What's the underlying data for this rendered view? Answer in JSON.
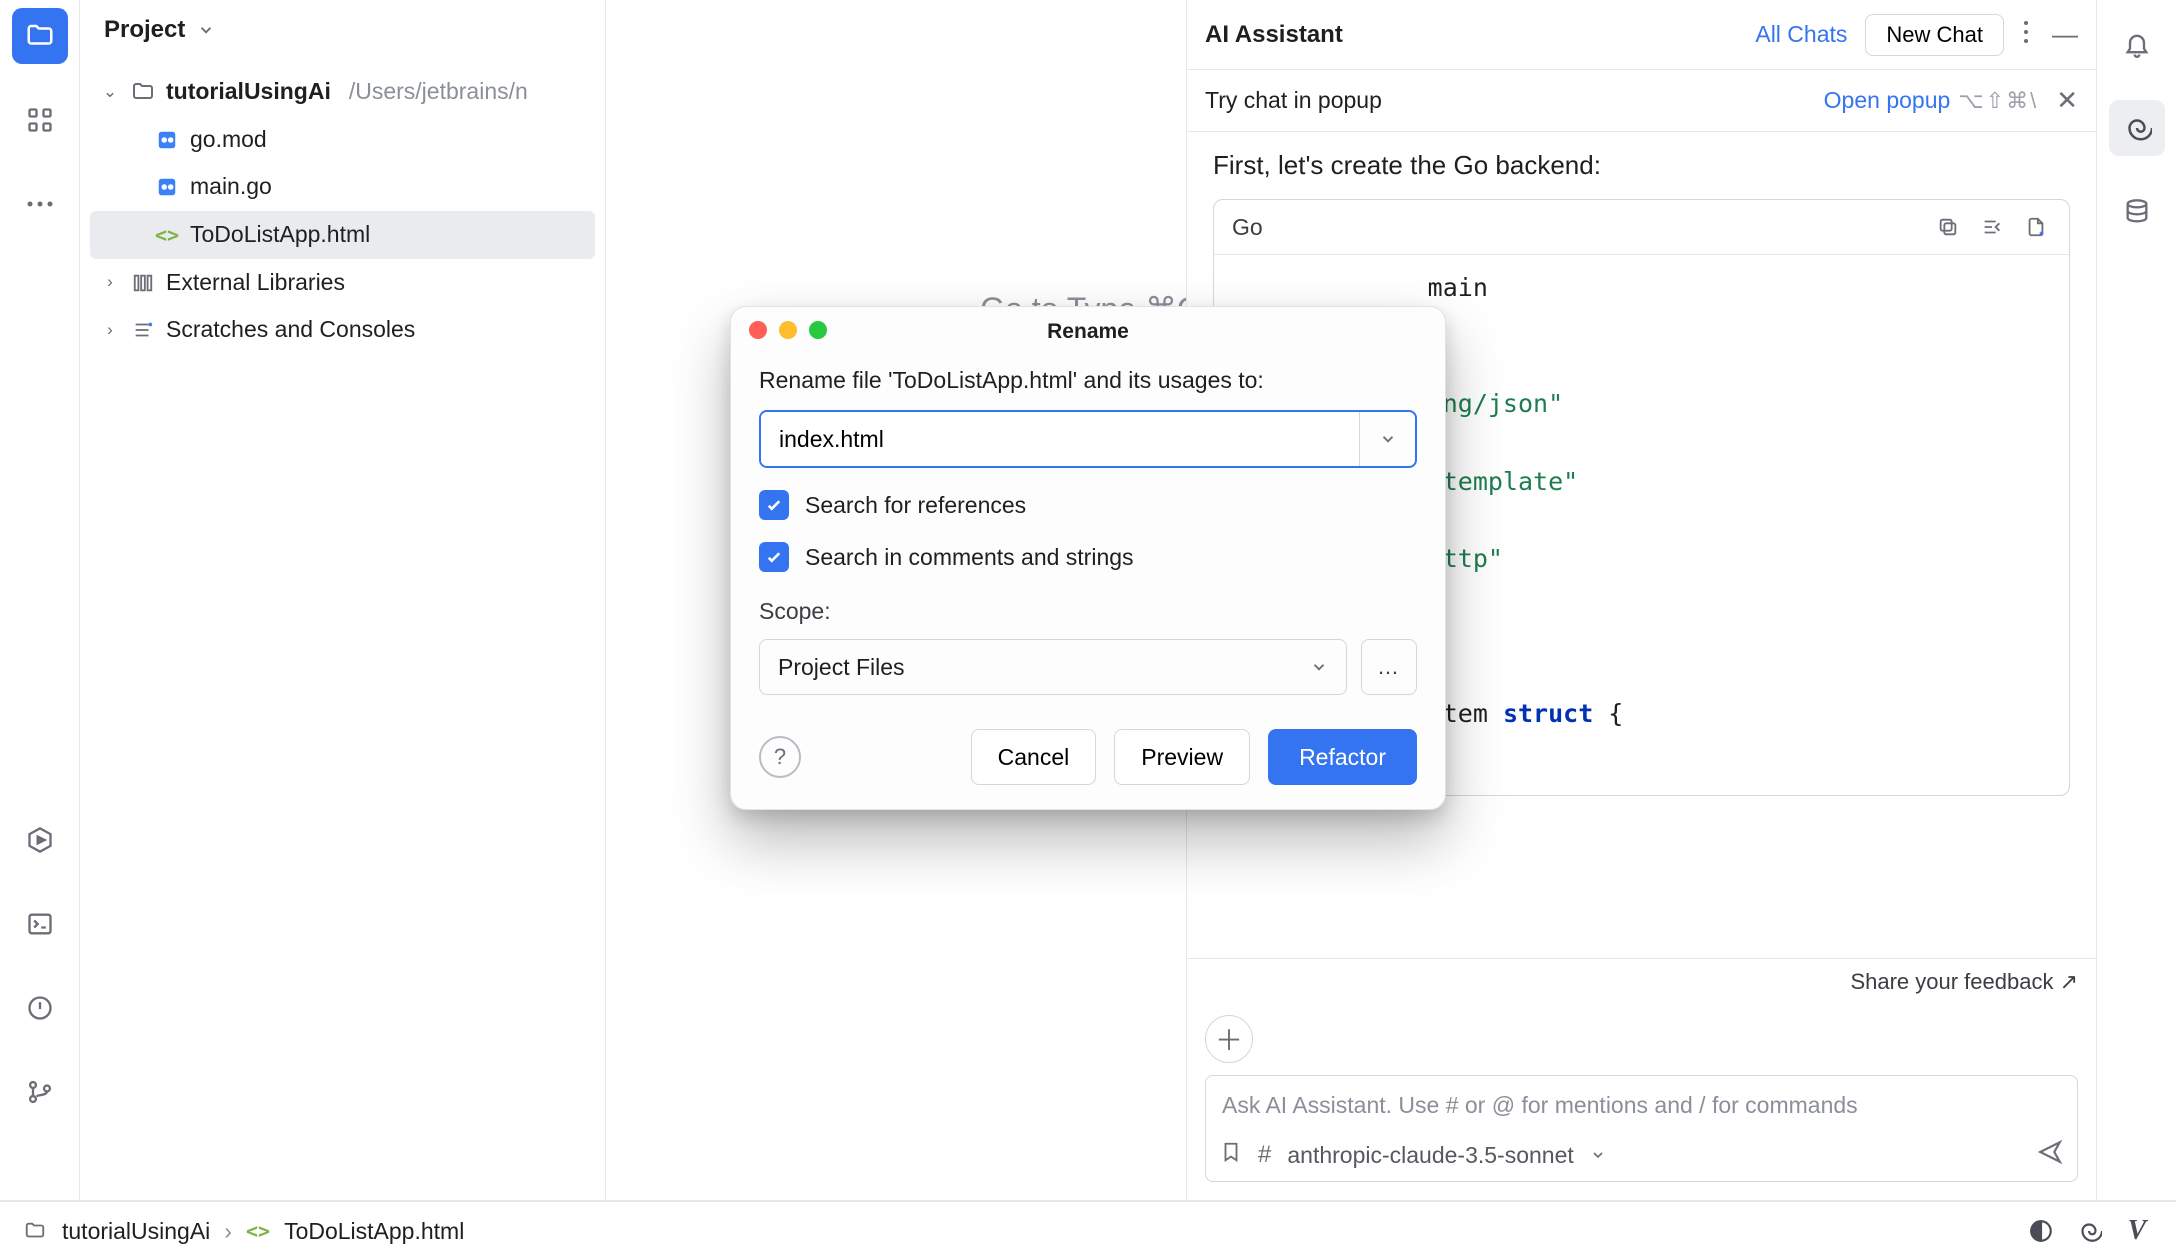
{
  "left_gutter": {
    "project_active": true
  },
  "project_panel": {
    "title": "Project",
    "root": {
      "name": "tutorialUsingAi",
      "path": "/Users/jetbrains/n"
    },
    "files": [
      {
        "icon": "go-file-icon",
        "name": "go.mod"
      },
      {
        "icon": "go-file-icon",
        "name": "main.go"
      },
      {
        "icon": "html-file-icon",
        "name": "ToDoListApp.html",
        "selected": true
      }
    ],
    "external_libs_label": "External Libraries",
    "scratches_label": "Scratches and Consoles"
  },
  "editor": {
    "placeholder_hint": "Go to Type ⌘O"
  },
  "ai": {
    "title": "AI Assistant",
    "all_chats": "All Chats",
    "new_chat": "New Chat",
    "popup_row_label": "Try chat in popup",
    "open_popup": "Open popup",
    "open_popup_shortcut": "⌥⇧⌘\\",
    "message": "First, let's create the Go backend:",
    "code_lang": "Go",
    "code_visible": "main\n\n\nding/json\"\n\"\nl/template\"\n\"\n/http\"\nc\"\n\n\noItem struct {",
    "feedback": "Share your feedback ↗",
    "input_placeholder": "Ask AI Assistant. Use # or @ for mentions and / for commands",
    "model": "anthropic-claude-3.5-sonnet"
  },
  "dialog": {
    "title": "Rename",
    "prompt": "Rename file 'ToDoListApp.html' and its usages to:",
    "value": "index.html",
    "chk_refs": "Search for references",
    "chk_comments": "Search in comments and strings",
    "scope_label": "Scope:",
    "scope_value": "Project Files",
    "scope_more": "…",
    "btn_cancel": "Cancel",
    "btn_preview": "Preview",
    "btn_refactor": "Refactor"
  },
  "status": {
    "crumb1": "tutorialUsingAi",
    "crumb2": "ToDoListApp.html"
  }
}
